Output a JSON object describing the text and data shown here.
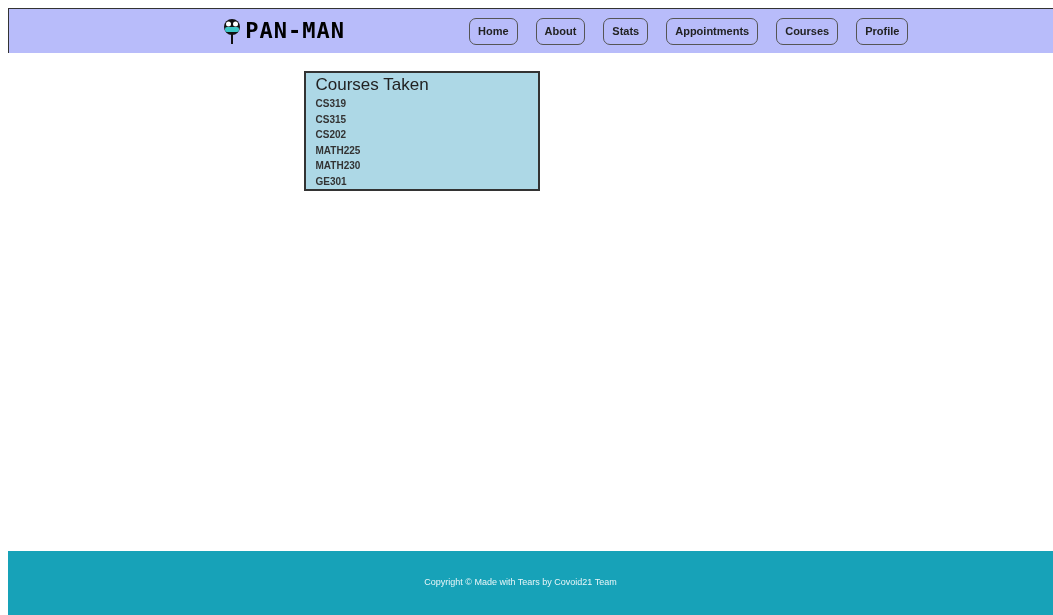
{
  "header": {
    "logo_text": "PAN-MAN",
    "nav": [
      {
        "label": "Home"
      },
      {
        "label": "About"
      },
      {
        "label": "Stats"
      },
      {
        "label": "Appointments"
      },
      {
        "label": "Courses"
      },
      {
        "label": "Profile"
      }
    ]
  },
  "courses_card": {
    "title": "Courses Taken",
    "courses": [
      "CS319",
      "CS315",
      "CS202",
      "MATH225",
      "MATH230",
      "GE301"
    ]
  },
  "footer": {
    "text": "Copyright © Made with Tears by Covoid21 Team"
  }
}
